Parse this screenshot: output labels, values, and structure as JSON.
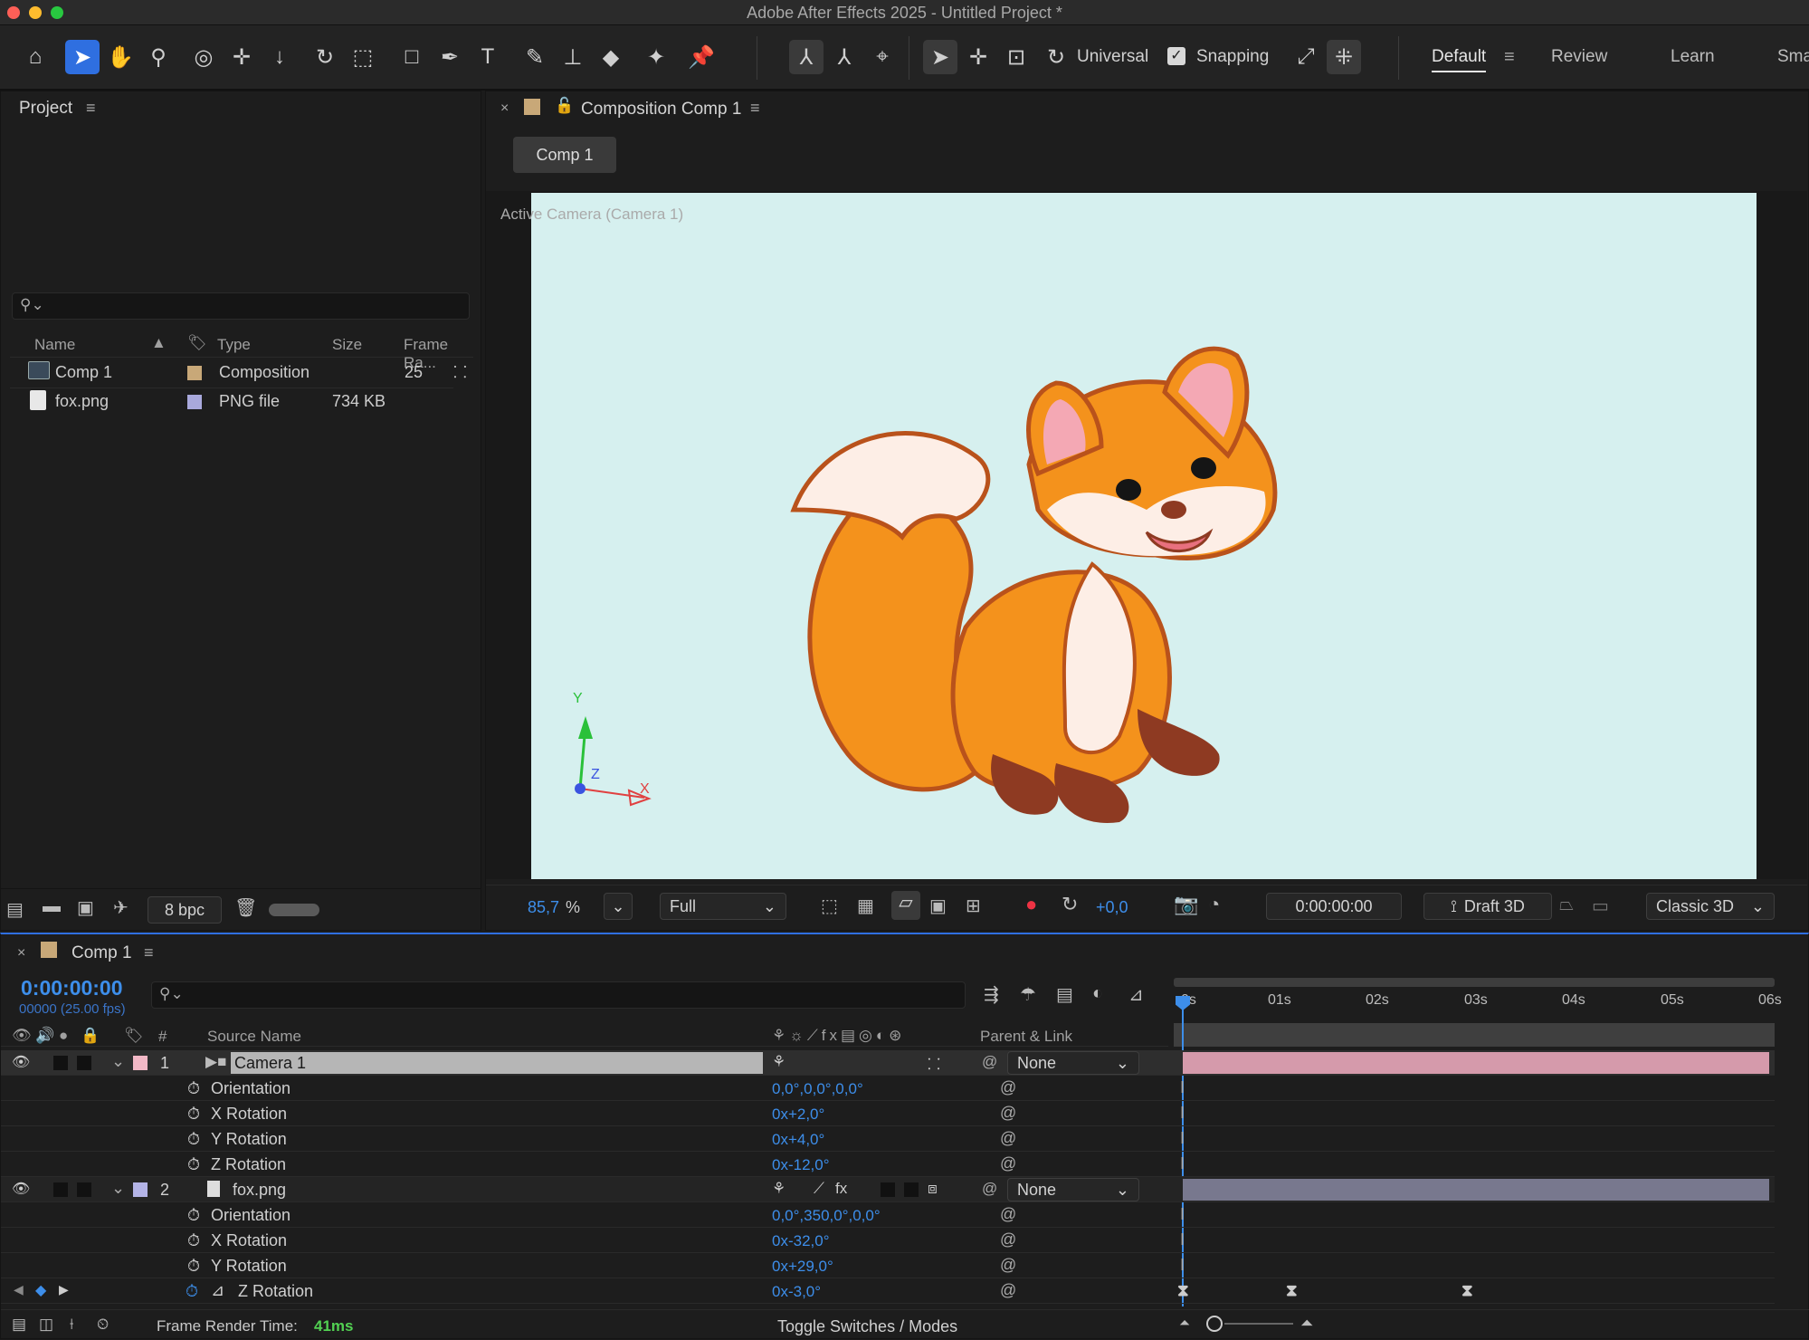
{
  "window": {
    "title": "Adobe After Effects 2025 - Untitled Project *"
  },
  "toolbar": {
    "universal_label": "Universal",
    "snapping_label": "Snapping",
    "workspaces": [
      "Default",
      "Review",
      "Learn",
      "Sma"
    ]
  },
  "project": {
    "title": "Project",
    "search_placeholder": "",
    "columns": {
      "name": "Name",
      "type": "Type",
      "size": "Size",
      "frame_rate": "Frame Ra..."
    },
    "items": [
      {
        "name": "Comp 1",
        "type": "Composition",
        "size": "",
        "frame_rate": "25",
        "label_color": "#c8a878"
      },
      {
        "name": "fox.png",
        "type": "PNG file",
        "size": "734 KB",
        "frame_rate": "",
        "label_color": "#a9a9dc"
      }
    ],
    "bpc": "8 bpc"
  },
  "composition": {
    "panel_title": "Composition Comp 1",
    "tab": "Comp 1",
    "viewer_label": "Active Camera (Camera 1)",
    "bg_color": "#d6f0ef",
    "axes": {
      "y": "Y",
      "z": "Z",
      "x": "X"
    },
    "zoom": "85,7",
    "zoom_unit": "%",
    "resolution": "Full",
    "exposure": "+0,0",
    "timecode": "0:00:00:00",
    "renderer": "Draft 3D",
    "renderer_mode": "Classic 3D"
  },
  "timeline": {
    "tab": "Comp 1",
    "current_time": "0:00:00:00",
    "frames": "00000 (25.00 fps)",
    "columns": {
      "num": "#",
      "source": "Source Name",
      "parent": "Parent & Link"
    },
    "ruler": [
      "0s",
      "01s",
      "02s",
      "03s",
      "04s",
      "05s",
      "06s"
    ],
    "layers": [
      {
        "num": "1",
        "name": "Camera 1",
        "parent": "None",
        "color": "#f2b8c6",
        "props": [
          {
            "name": "Orientation",
            "value": "0,0°,0,0°,0,0°"
          },
          {
            "name": "X Rotation",
            "value": "0x+2,0°"
          },
          {
            "name": "Y Rotation",
            "value": "0x+4,0°"
          },
          {
            "name": "Z Rotation",
            "value": "0x-12,0°"
          }
        ]
      },
      {
        "num": "2",
        "name": "fox.png",
        "parent": "None",
        "color": "#b3b3e6",
        "props": [
          {
            "name": "Orientation",
            "value": "0,0°,350,0°,0,0°"
          },
          {
            "name": "X Rotation",
            "value": "0x-32,0°"
          },
          {
            "name": "Y Rotation",
            "value": "0x+29,0°"
          },
          {
            "name": "Z Rotation",
            "value": "0x-3,0°"
          }
        ]
      }
    ],
    "footer": {
      "render_label": "Frame Render Time:",
      "render_value": "41ms",
      "toggle": "Toggle Switches / Modes"
    }
  }
}
